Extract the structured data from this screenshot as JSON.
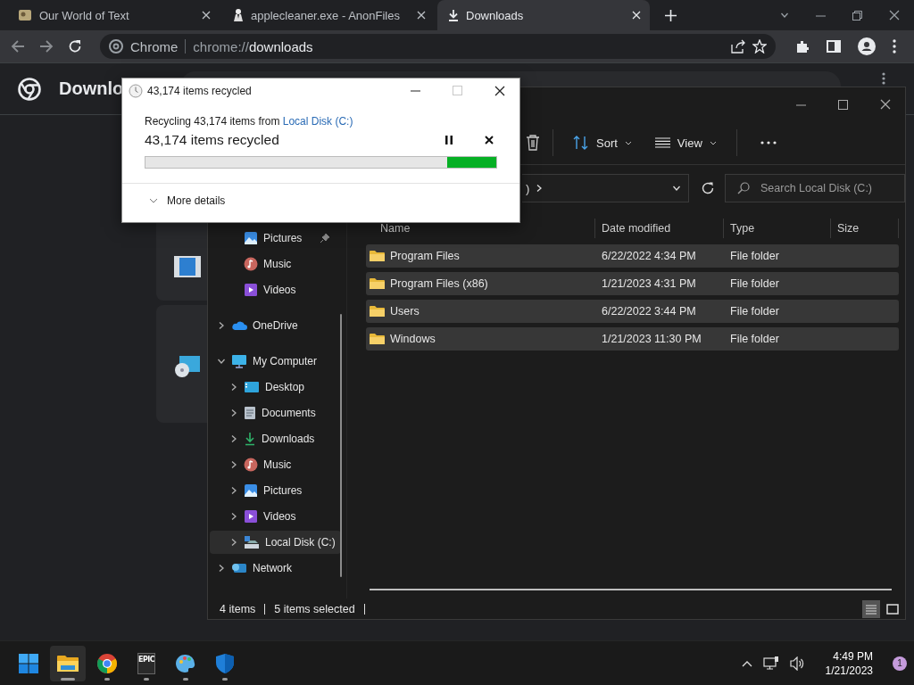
{
  "browser": {
    "tabs": [
      {
        "title": "Our World of Text",
        "kind": "page",
        "selected": false
      },
      {
        "title": "applecleaner.exe - AnonFiles",
        "kind": "file",
        "selected": false
      },
      {
        "title": "Downloads",
        "kind": "download",
        "selected": true
      }
    ],
    "omnibox": {
      "site_label": "Chrome",
      "url": "chrome://**downloads**"
    },
    "page": {
      "title": "Downlo"
    }
  },
  "explorer": {
    "toolbar": [
      {
        "label": "Sort",
        "kind": "sort"
      },
      {
        "label": "View",
        "kind": "view"
      }
    ],
    "breadcrumb": ")",
    "search": {
      "placeholder": "Search Local Disk (C:)"
    },
    "quick_access": [
      {
        "label": "Pictures",
        "kind": "pictures",
        "pinned": true
      },
      {
        "label": "Music",
        "kind": "music",
        "pinned": false
      },
      {
        "label": "Videos",
        "kind": "videos",
        "pinned": false
      }
    ],
    "tree": [
      {
        "label": "OneDrive",
        "kind": "cloud",
        "expanded": false,
        "selected": false
      },
      {
        "label": "My Computer",
        "kind": "computer",
        "expanded": true,
        "selected": false,
        "children": [
          {
            "label": "Desktop",
            "kind": "desktop",
            "expanded": false,
            "selected": false
          },
          {
            "label": "Documents",
            "kind": "documents",
            "expanded": false,
            "selected": false
          },
          {
            "label": "Downloads",
            "kind": "downloads",
            "expanded": false,
            "selected": false
          },
          {
            "label": "Music",
            "kind": "music",
            "expanded": false,
            "selected": false
          },
          {
            "label": "Pictures",
            "kind": "pictures",
            "expanded": false,
            "selected": false
          },
          {
            "label": "Videos",
            "kind": "videos",
            "expanded": false,
            "selected": false
          },
          {
            "label": "Local Disk (C:)",
            "kind": "disk",
            "expanded": false,
            "selected": true
          }
        ]
      },
      {
        "label": "Network",
        "kind": "network",
        "expanded": false,
        "selected": false
      }
    ],
    "columns": [
      "Name",
      "Date modified",
      "Type",
      "Size"
    ],
    "rows": [
      {
        "name": "Program Files",
        "date": "6/22/2022 4:34 PM",
        "type": "File folder",
        "selected": true
      },
      {
        "name": "Program Files (x86)",
        "date": "1/21/2023 4:31 PM",
        "type": "File folder",
        "selected": true
      },
      {
        "name": "Users",
        "date": "6/22/2022 3:44 PM",
        "type": "File folder",
        "selected": true
      },
      {
        "name": "Windows",
        "date": "1/21/2023 11:30 PM",
        "type": "File folder",
        "selected": true
      }
    ],
    "status": {
      "items": "4 items",
      "selected": "5 items selected"
    },
    "view_modes": [
      {
        "kind": "details",
        "selected": true
      },
      {
        "kind": "tiles",
        "selected": false
      }
    ]
  },
  "dialog": {
    "title": "43,174 items recycled",
    "can_maximize": false,
    "source_text": "Recycling 43,174 items from ",
    "source_link": "Local Disk (C:)",
    "status": "43,174 items recycled",
    "progress": {
      "level": 0.14
    },
    "details": "More details"
  },
  "taskbar": {
    "apps": [
      {
        "kind": "start",
        "running": false,
        "active": false
      },
      {
        "kind": "explorer",
        "running": true,
        "active": true
      },
      {
        "kind": "chrome",
        "running": true,
        "active": false
      },
      {
        "kind": "epic",
        "label": "EPIC",
        "running": true,
        "active": false
      },
      {
        "kind": "paint",
        "running": true,
        "active": false
      },
      {
        "kind": "defender",
        "running": true,
        "active": false
      }
    ],
    "time": "4:49 PM",
    "date": "1/21/2023",
    "notifications": "1"
  }
}
